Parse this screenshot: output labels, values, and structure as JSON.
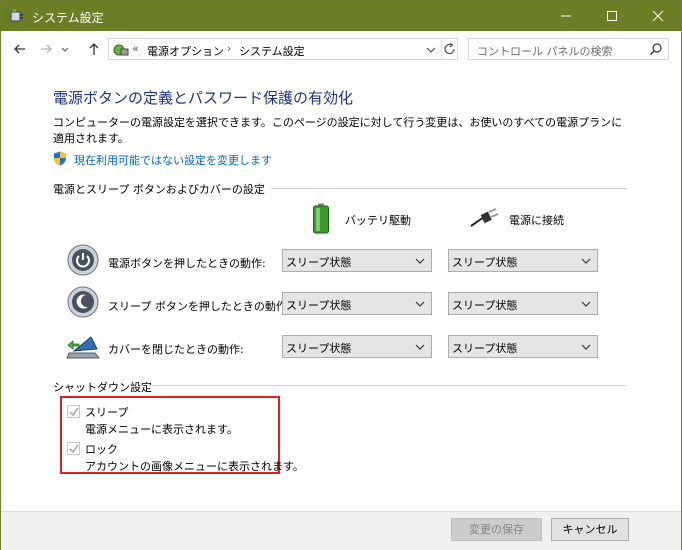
{
  "window": {
    "title": "システム設定",
    "accent_color": "#6b7e24"
  },
  "address": {
    "overflow": "«",
    "crumbs": [
      "電源オプション",
      "システム設定"
    ],
    "separator": "›",
    "search_placeholder": "コントロール パネルの検索"
  },
  "page": {
    "title": "電源ボタンの定義とパスワード保護の有効化",
    "description": "コンピューターの電源設定を選択できます。このページの設定に対して行う変更は、お使いのすべての電源プランに適用されます。",
    "admin_link": "現在利用可能ではない設定を変更します"
  },
  "power_section": {
    "heading": "電源とスリープ ボタンおよびカバーの設定",
    "col_battery": "バッテリ駆動",
    "col_plugged": "電源に接続",
    "rows": [
      {
        "label": "電源ボタンを押したときの動作:",
        "battery": "スリープ状態",
        "plugged": "スリープ状態",
        "icon": "power-button-icon"
      },
      {
        "label": "スリープ ボタンを押したときの動作:",
        "battery": "スリープ状態",
        "plugged": "スリープ状態",
        "icon": "sleep-button-icon"
      },
      {
        "label": "カバーを閉じたときの動作:",
        "battery": "スリープ状態",
        "plugged": "スリープ状態",
        "icon": "laptop-lid-icon"
      }
    ]
  },
  "shutdown_section": {
    "heading": "シャットダウン設定",
    "items": [
      {
        "label": "スリープ",
        "desc": "電源メニューに表示されます。",
        "checked": true
      },
      {
        "label": "ロック",
        "desc": "アカウントの画像メニューに表示されます。",
        "checked": true
      }
    ]
  },
  "footer": {
    "save": "変更の保存",
    "cancel": "キャンセル"
  }
}
